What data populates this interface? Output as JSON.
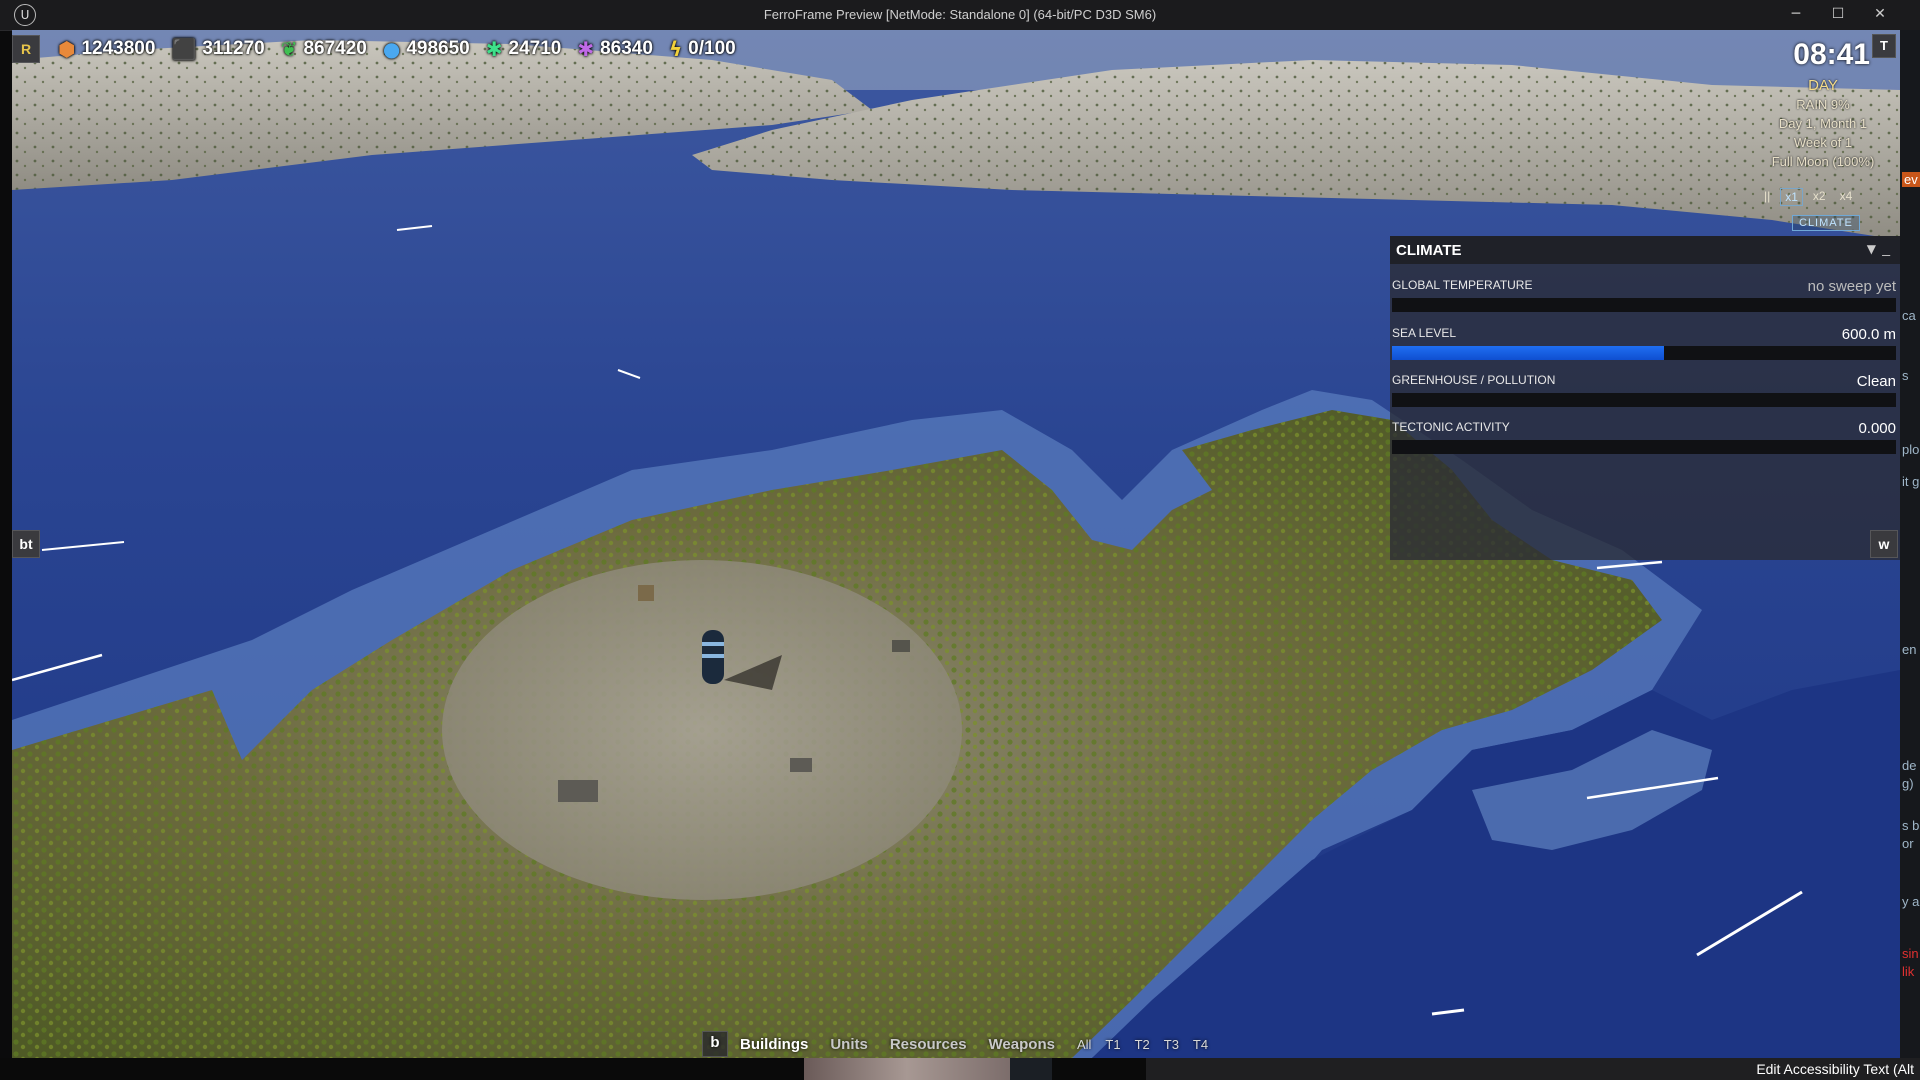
{
  "window": {
    "title": "FerroFrame Preview [NetMode: Standalone 0]  (64-bit/PC D3D SM6)",
    "minimize_glyph": "─",
    "maximize_glyph": "☐",
    "close_glyph": "✕"
  },
  "hud": {
    "r_button": "R",
    "resources": [
      {
        "icon": "hexagon-icon",
        "glyph": "⬢",
        "color": "#e8893a",
        "value": "1243800"
      },
      {
        "icon": "cubes-icon",
        "glyph": "⬛",
        "color": "#cfd3d8",
        "value": "311270"
      },
      {
        "icon": "leaf-icon",
        "glyph": "❦",
        "color": "#3fbf52",
        "value": "867420"
      },
      {
        "icon": "water-drop-icon",
        "glyph": "💧",
        "color": "#4aa8f0",
        "value": "498650"
      },
      {
        "icon": "bug-icon",
        "glyph": "✱",
        "color": "#3ee08a",
        "value": "24710"
      },
      {
        "icon": "crystal-icon",
        "glyph": "✱",
        "color": "#c06ae8",
        "value": "86340"
      },
      {
        "icon": "lightning-icon",
        "glyph": "⚡",
        "color": "#f2d23a",
        "value": "0/100"
      }
    ],
    "clock": "08:41",
    "t_button": "T",
    "period": "DAY",
    "weather": "RAIN 9%",
    "date": "Day 1, Month 1",
    "week": "Week of 1",
    "moon": "Full Moon (100%)",
    "speeds": [
      "||",
      "x1",
      "x2",
      "x4"
    ],
    "selected_speed": "x1",
    "climate_toggle": "CLIMATE"
  },
  "climate_panel": {
    "title": "CLIMATE",
    "collapse_glyph": "▼",
    "minimize_glyph": "_",
    "metrics": [
      {
        "label": "GLOBAL TEMPERATURE",
        "value": "no sweep yet",
        "fill": 0
      },
      {
        "label": "SEA LEVEL",
        "value": "600.0 m",
        "fill": 0.54
      },
      {
        "label": "GREENHOUSE / POLLUTION",
        "value": "Clean",
        "fill": 0
      },
      {
        "label": "TECTONIC ACTIVITY",
        "value": "0.000",
        "fill": 0
      }
    ]
  },
  "side_buttons": {
    "left": "bt",
    "right": "w"
  },
  "build_bar": {
    "key": "b",
    "categories": [
      "Buildings",
      "Units",
      "Resources",
      "Weapons"
    ],
    "active": "Buildings",
    "tiers": [
      "All",
      "T1",
      "T2",
      "T3",
      "T4"
    ]
  },
  "background_window": {
    "fragments": [
      "ev",
      "ca",
      "s",
      "plo",
      "it g",
      "en",
      "de",
      "g)",
      "s b",
      "or",
      "y a",
      "sin",
      "lik"
    ],
    "status_text": "Edit Accessibility Text (Alt"
  }
}
